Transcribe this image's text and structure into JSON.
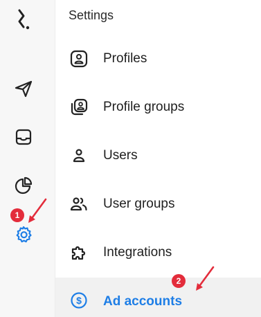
{
  "rail": {
    "items": [
      {
        "name": "logo",
        "icon": "brand-logo-icon"
      },
      {
        "name": "publish",
        "icon": "paper-plane-icon"
      },
      {
        "name": "inbox",
        "icon": "inbox-icon"
      },
      {
        "name": "reports",
        "icon": "pie-chart-icon"
      },
      {
        "name": "settings",
        "icon": "gear-icon",
        "active": true
      }
    ],
    "active_color": "#1e7ee6"
  },
  "settings": {
    "title": "Settings",
    "items": [
      {
        "label": "Profiles",
        "icon": "profile-card-icon"
      },
      {
        "label": "Profile groups",
        "icon": "profile-groups-icon"
      },
      {
        "label": "Users",
        "icon": "user-icon"
      },
      {
        "label": "User groups",
        "icon": "user-groups-icon"
      },
      {
        "label": "Integrations",
        "icon": "puzzle-icon"
      },
      {
        "label": "Ad accounts",
        "icon": "dollar-circle-icon",
        "active": true
      }
    ]
  },
  "annotations": {
    "step1": "1",
    "step2": "2",
    "color": "#e32c3b"
  }
}
